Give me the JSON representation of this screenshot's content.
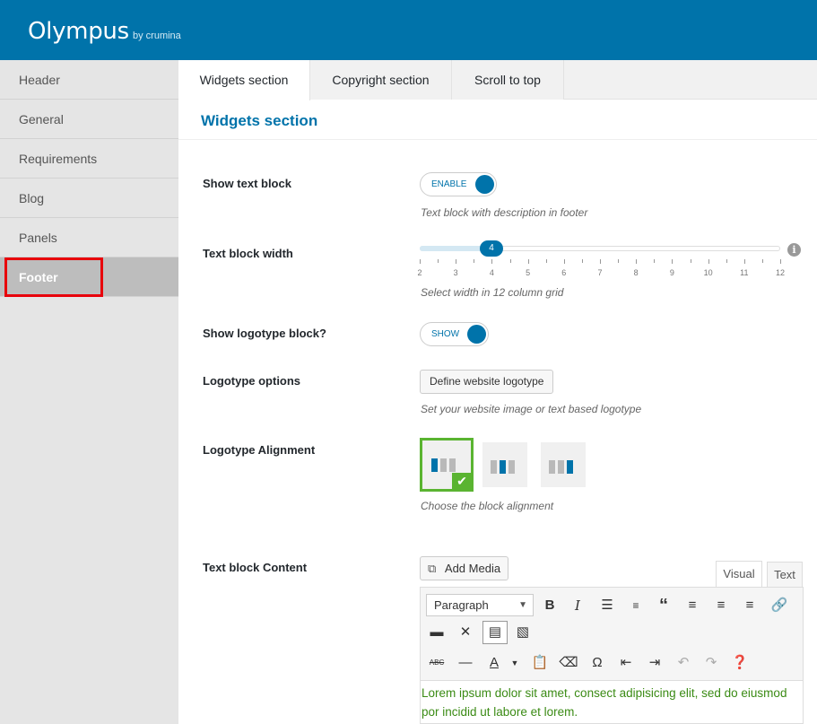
{
  "brand": {
    "name": "Olympus",
    "by": "by crumina"
  },
  "sidebar": {
    "items": [
      {
        "label": "Header"
      },
      {
        "label": "General"
      },
      {
        "label": "Requirements"
      },
      {
        "label": "Blog"
      },
      {
        "label": "Panels"
      },
      {
        "label": "Footer",
        "active": true
      }
    ]
  },
  "tabs": [
    {
      "label": "Widgets section",
      "active": true
    },
    {
      "label": "Copyright section"
    },
    {
      "label": "Scroll to top"
    }
  ],
  "section": {
    "title": "Widgets section"
  },
  "fields": {
    "show_text_block": {
      "label": "Show text block",
      "toggle": "ENABLE",
      "desc": "Text block with description in footer"
    },
    "text_block_width": {
      "label": "Text block width",
      "value": "4",
      "min": 2,
      "max": 12,
      "tick_labels": [
        "2",
        "3",
        "4",
        "5",
        "6",
        "7",
        "8",
        "9",
        "10",
        "11",
        "12"
      ],
      "desc": "Select width in 12 column grid",
      "info": "i"
    },
    "show_logotype": {
      "label": "Show logotype block?",
      "toggle": "SHOW"
    },
    "logotype_options": {
      "label": "Logotype options",
      "button": "Define website logotype",
      "desc": "Set your website image or text based logotype"
    },
    "logotype_alignment": {
      "label": "Logotype Alignment",
      "selected": "left",
      "desc": "Choose the block alignment"
    },
    "text_block_content": {
      "label": "Text block Content",
      "add_media": "Add Media",
      "visual_tab": "Visual",
      "text_tab": "Text",
      "format": "Paragraph",
      "content": "Lorem ipsum dolor sit amet, consect adipisicing elit, sed do eiusmod por incidid ut labore et lorem."
    }
  },
  "colors": {
    "primary": "#0073aa",
    "accent_green": "#5ab431",
    "highlight_red": "#e8000b",
    "editor_text": "#3b8b15"
  }
}
